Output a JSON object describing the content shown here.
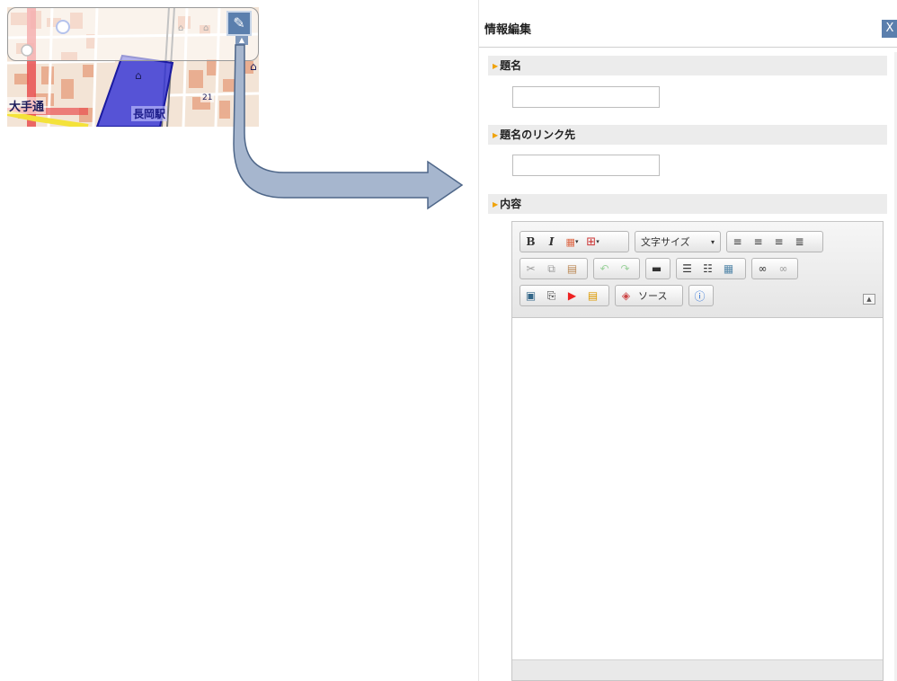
{
  "map": {
    "labels": {
      "street": "大手通",
      "station": "長岡駅",
      "number": "21"
    },
    "edit_icon": "pencil-icon",
    "toggle_icon": "caret-up-icon"
  },
  "panel": {
    "title": "情報編集",
    "close_label": "X",
    "sections": {
      "title": "題名",
      "link": "題名のリンク先",
      "content": "内容"
    },
    "fields": {
      "title_value": "",
      "link_value": ""
    },
    "toolbar": {
      "bold": "B",
      "italic": "I",
      "font_size": "文字サイズ",
      "source": "ソース"
    }
  },
  "colors": {
    "accent": "#5b7fad",
    "section_marker": "#f0a30a",
    "station_area": "#3a3ad6",
    "arrow_fill": "#a6b6ce",
    "arrow_stroke": "#4f6789"
  }
}
